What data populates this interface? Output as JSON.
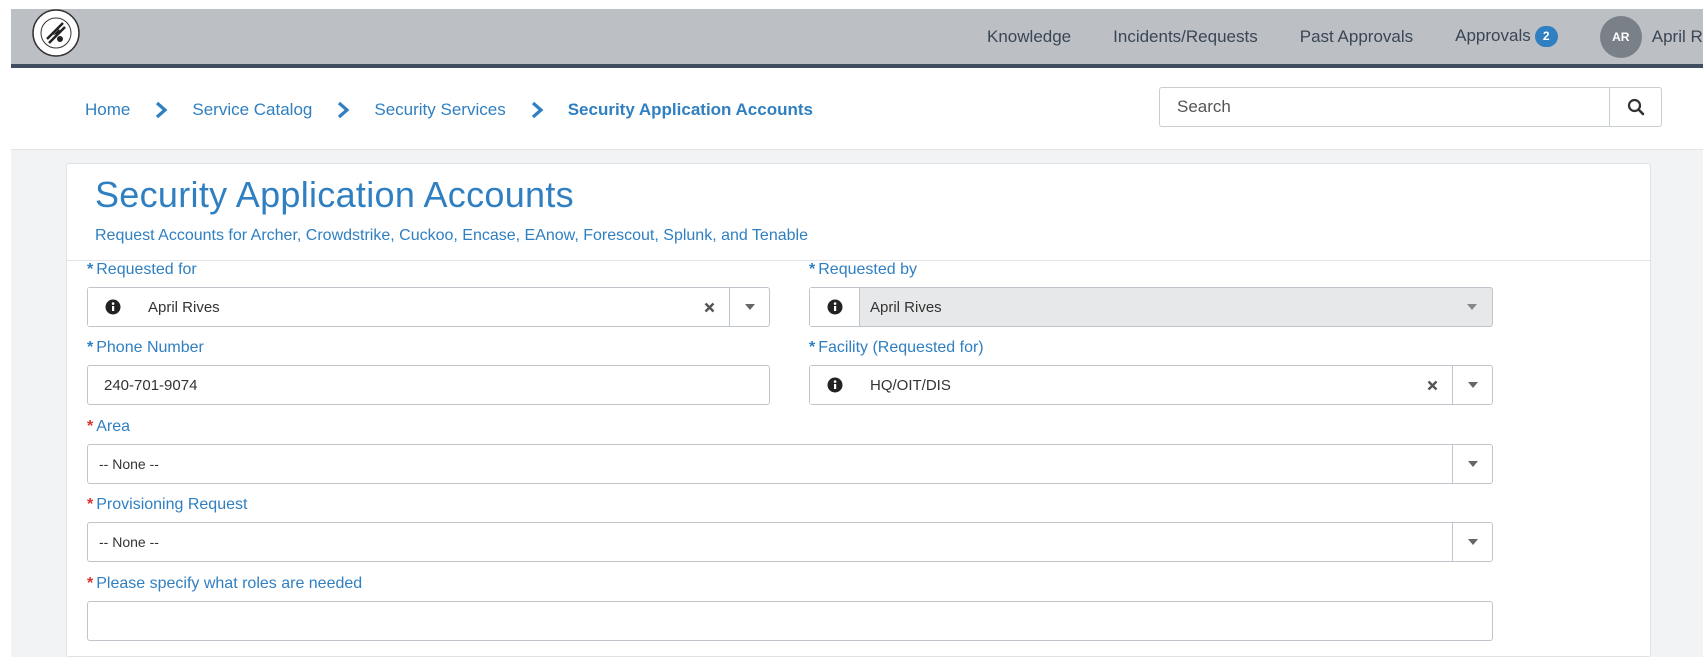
{
  "header": {
    "nav": [
      {
        "label": "Knowledge"
      },
      {
        "label": "Incidents/Requests"
      },
      {
        "label": "Past Approvals"
      },
      {
        "label": "Approvals",
        "badge": "2"
      }
    ],
    "user": {
      "initials": "AR",
      "name": "April Rives"
    }
  },
  "breadcrumb": [
    "Home",
    "Service Catalog",
    "Security Services",
    "Security Application Accounts"
  ],
  "search": {
    "placeholder": "Search"
  },
  "form": {
    "title": "Security Application Accounts",
    "subtitle": "Request Accounts for Archer, Crowdstrike, Cuckoo, Encase, EAnow, Forescout, Splunk, and Tenable",
    "requested_for": {
      "label": "Requested for",
      "value": "April Rives"
    },
    "requested_by": {
      "label": "Requested by",
      "value": "April Rives"
    },
    "phone": {
      "label": "Phone Number",
      "value": "240-701-9074"
    },
    "facility": {
      "label": "Facility (Requested for)",
      "value": "HQ/OIT/DIS"
    },
    "area": {
      "label": "Area",
      "value": "-- None --"
    },
    "provisioning": {
      "label": "Provisioning Request",
      "value": "-- None --"
    },
    "roles": {
      "label": "Please specify what roles are needed"
    }
  },
  "colors": {
    "accent": "#2f7fc1",
    "header": "#bcc0c4",
    "required_mandatory": "#d9342b"
  }
}
